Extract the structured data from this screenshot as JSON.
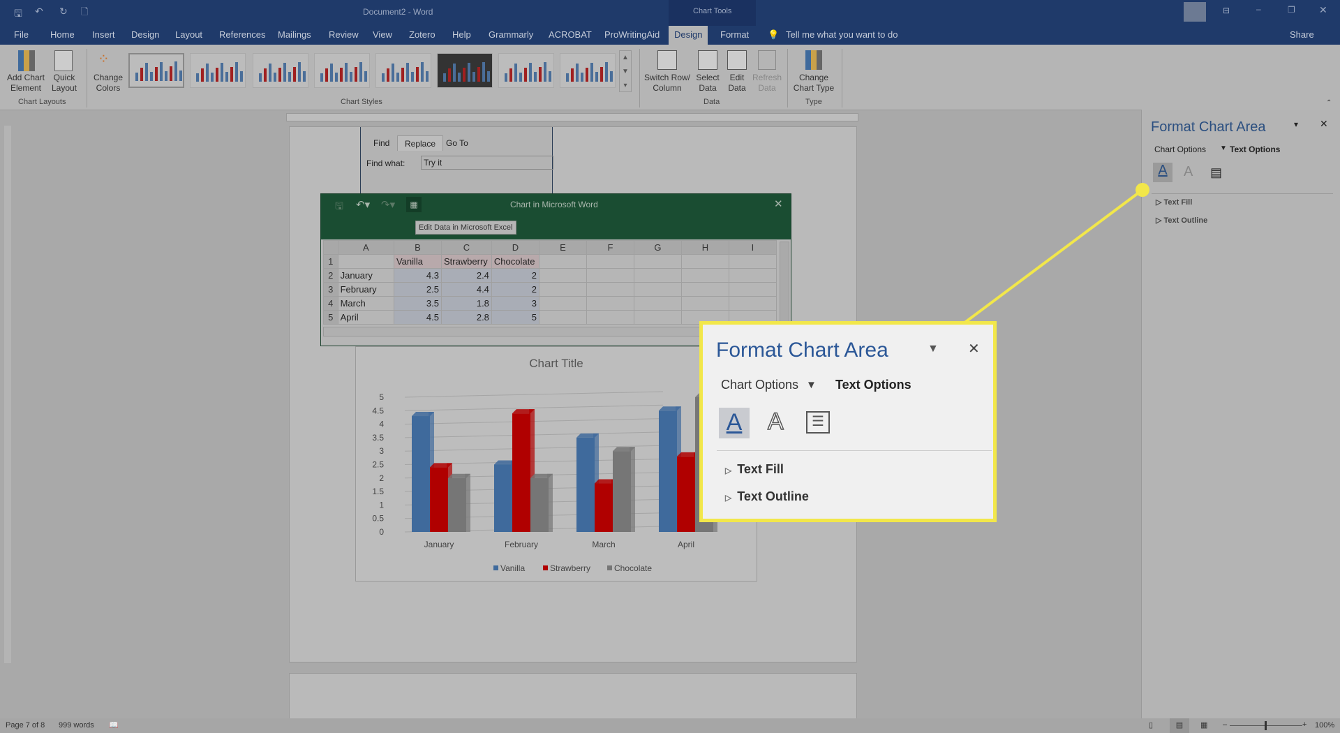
{
  "titlebar": {
    "title": "Document2 - Word",
    "context": "Chart Tools"
  },
  "tabs": [
    "File",
    "Home",
    "Insert",
    "Design",
    "Layout",
    "References",
    "Mailings",
    "Review",
    "View",
    "Zotero",
    "Help",
    "Grammarly",
    "ACROBAT",
    "ProWritingAid",
    "Design",
    "Format"
  ],
  "tell_me": "Tell me what you want to do",
  "share": "Share",
  "ribbon": {
    "add_chart": "Add Chart Element",
    "quick_layout": "Quick Layout",
    "change_colors": "Change Colors",
    "switch": "Switch Row/ Column",
    "select_data": "Select Data",
    "edit_data": "Edit Data",
    "refresh": "Refresh Data",
    "change_type": "Change Chart Type",
    "groups": {
      "layouts": "Chart Layouts",
      "styles": "Chart Styles",
      "data": "Data",
      "type": "Type"
    }
  },
  "find": {
    "tabs": [
      "Find",
      "Replace",
      "Go To"
    ],
    "label": "Find what:",
    "value": "Try it"
  },
  "excel": {
    "title": "Chart in Microsoft Word",
    "tooltip": "Edit Data in Microsoft Excel",
    "columns": [
      "A",
      "B",
      "C",
      "D",
      "E",
      "F",
      "G",
      "H",
      "I"
    ],
    "rows": [
      [
        "",
        "Vanilla",
        "Strawberry",
        "Chocolate"
      ],
      [
        "January",
        "4.3",
        "2.4",
        "2"
      ],
      [
        "February",
        "2.5",
        "4.4",
        "2"
      ],
      [
        "March",
        "3.5",
        "1.8",
        "3"
      ],
      [
        "April",
        "4.5",
        "2.8",
        "5"
      ]
    ]
  },
  "chart_data": {
    "type": "bar",
    "title": "Chart Title",
    "categories": [
      "January",
      "February",
      "March",
      "April"
    ],
    "series": [
      {
        "name": "Vanilla",
        "values": [
          4.3,
          2.5,
          3.5,
          4.5
        ],
        "color": "#3f6a9c"
      },
      {
        "name": "Strawberry",
        "values": [
          2.4,
          4.4,
          1.8,
          2.8
        ],
        "color": "#b00000"
      },
      {
        "name": "Chocolate",
        "values": [
          2,
          2,
          3,
          5
        ],
        "color": "#767676"
      }
    ],
    "yticks": [
      "0",
      "0.5",
      "1",
      "1.5",
      "2",
      "2.5",
      "3",
      "3.5",
      "4",
      "4.5",
      "5"
    ],
    "ylim": [
      0,
      5
    ],
    "grid": true,
    "legend": "bottom"
  },
  "pane": {
    "title": "Format Chart Area",
    "chart_options": "Chart Options",
    "text_options": "Text Options",
    "text_fill": "Text Fill",
    "text_outline": "Text Outline"
  },
  "status": {
    "page": "Page 7 of 8",
    "words": "999 words",
    "zoom": "100%"
  },
  "colors": {
    "callout": "#f2e74a",
    "titlebar": "#1f3a6a"
  }
}
